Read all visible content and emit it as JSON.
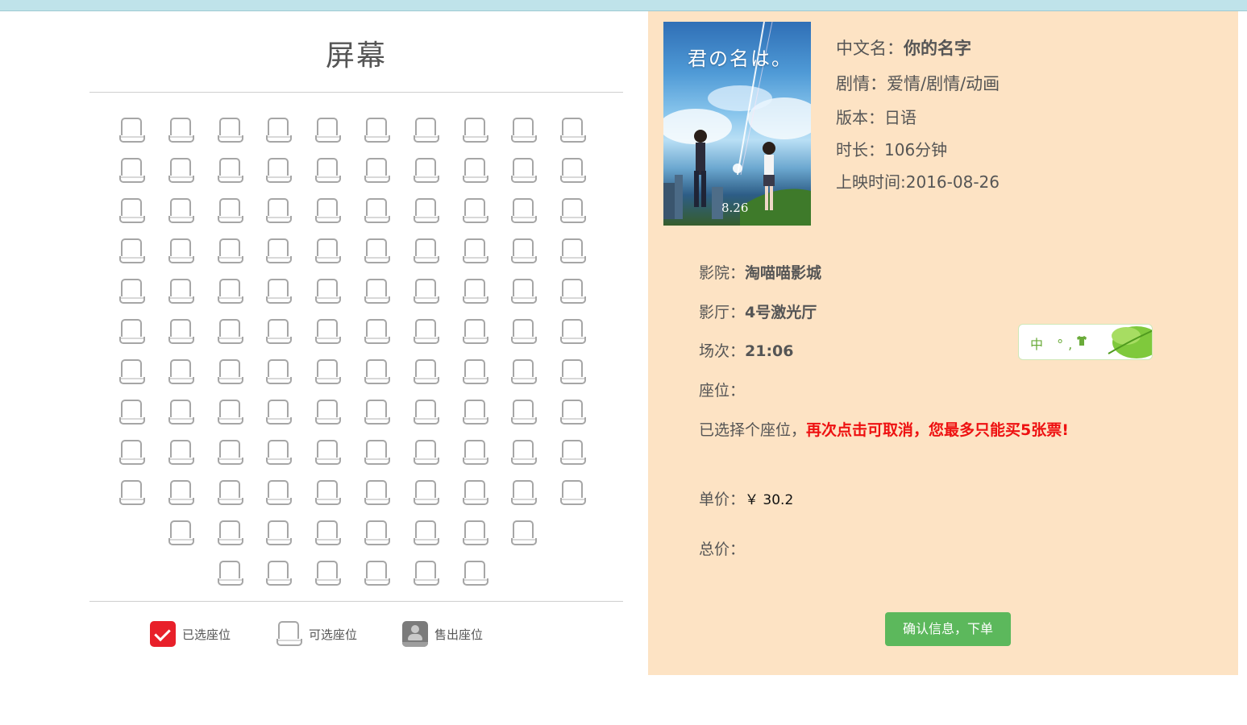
{
  "screen": {
    "title": "屏幕"
  },
  "seat_layout": {
    "rows": [
      10,
      10,
      10,
      10,
      10,
      10,
      10,
      10,
      10,
      10,
      8,
      6
    ]
  },
  "legend": [
    {
      "label": "已选座位",
      "kind": "selected"
    },
    {
      "label": "可选座位",
      "kind": "available"
    },
    {
      "label": "售出座位",
      "kind": "sold"
    }
  ],
  "poster": {
    "title_text": "君の名は。",
    "date_text": "8.26"
  },
  "movie": {
    "name_label": "中文名：",
    "name": "你的名字",
    "genre_label": "剧情：",
    "genre": "爱情/剧情/动画",
    "version_label": "版本：",
    "version": "日语",
    "duration_label": "时长：",
    "duration": "106分钟",
    "release_label": "上映时间:",
    "release": "2016-08-26"
  },
  "order": {
    "cinema_label": "影院：",
    "cinema": "淘喵喵影城",
    "hall_label": "影厅：",
    "hall": "4号激光厅",
    "session_label": "场次：",
    "session": "21:06",
    "seats_label": "座位：",
    "seats": "",
    "selected_note_prefix": "已选择个座位，",
    "selected_note_warning": "再次点击可取消，您最多只能买5张票!",
    "unit_price_label": "单价：",
    "unit_price": "￥ 30.2",
    "total_label": "总价：",
    "total": ""
  },
  "confirm_button": "确认信息，下单",
  "ime": {
    "text": "中 °, ",
    "icon": "shirt-icon"
  },
  "colors": {
    "panel_bg": "#fde3c4",
    "warning_red": "#ee1111",
    "button_green": "#5cb85c",
    "selected_seat": "#e8202a",
    "sold_seat": "#7b7b7b"
  }
}
